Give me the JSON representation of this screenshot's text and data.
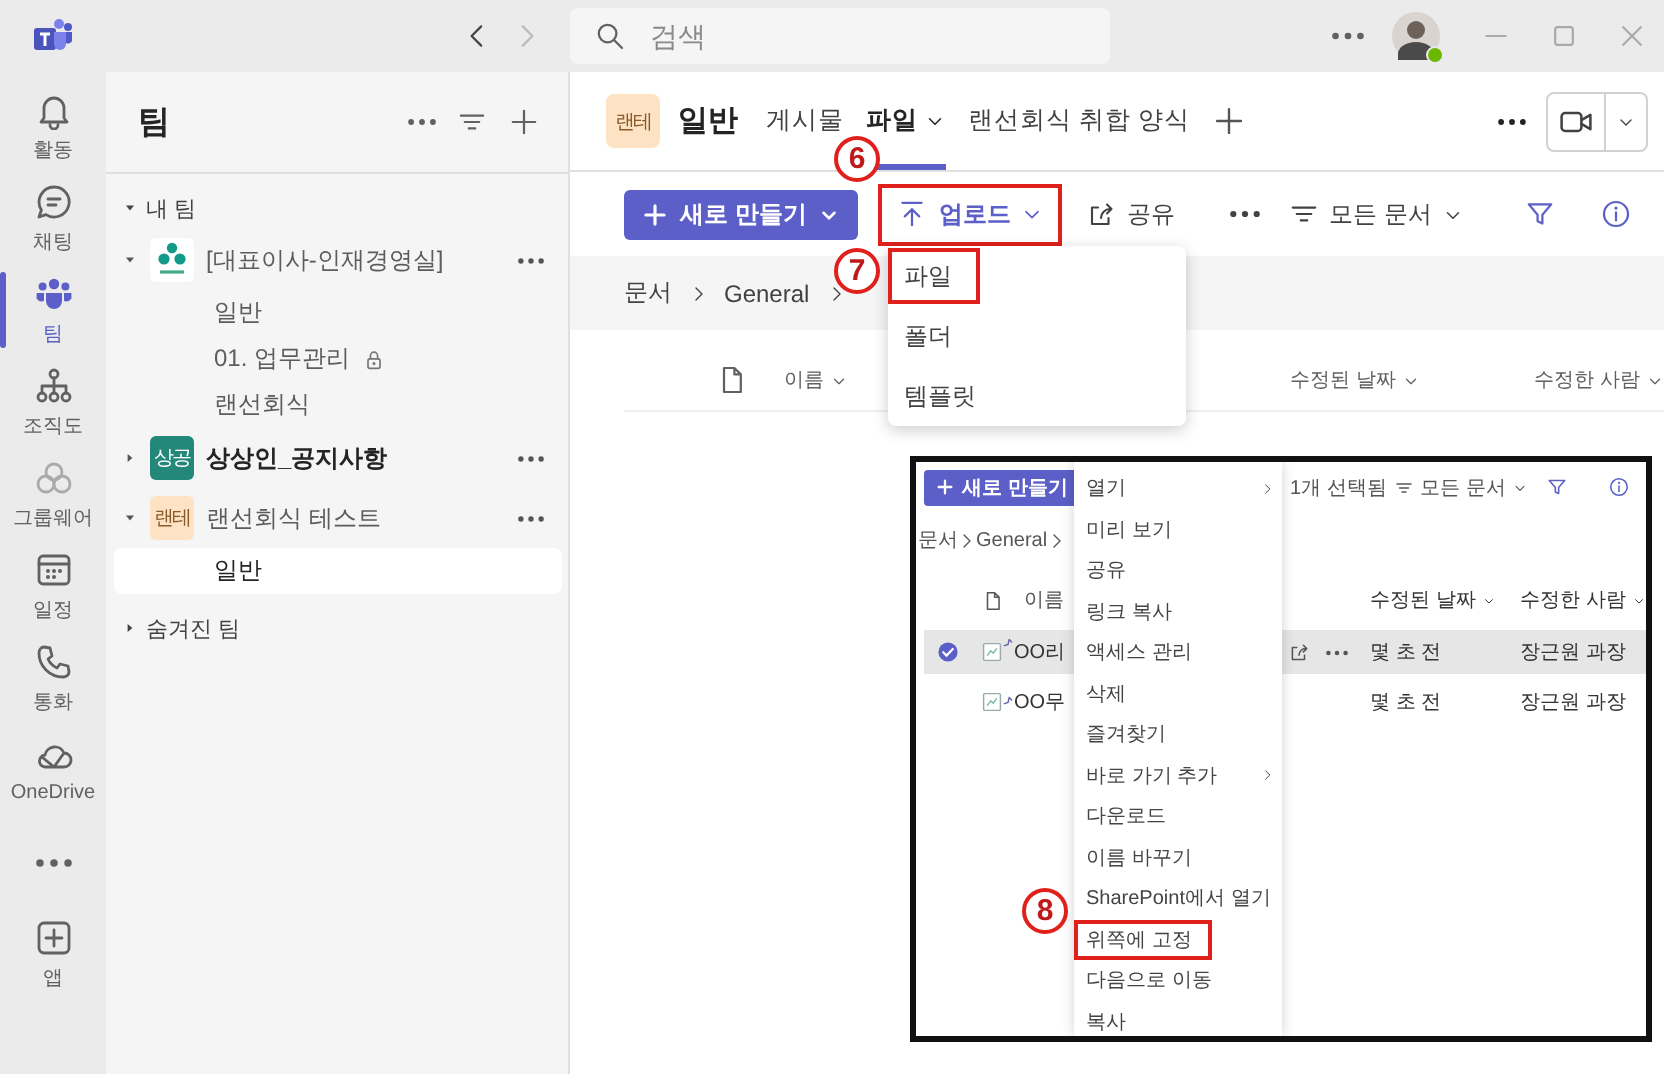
{
  "title_bar": {
    "search": {
      "placeholder": "검색"
    },
    "user": {
      "online": true
    }
  },
  "rail": [
    {
      "kind": "activity",
      "label": "활동",
      "selected": false
    },
    {
      "kind": "chat",
      "label": "채팅",
      "selected": false
    },
    {
      "kind": "teams",
      "label": "팀",
      "selected": true
    },
    {
      "kind": "org",
      "label": "조직도",
      "selected": false
    },
    {
      "kind": "groupware",
      "label": "그룹웨어",
      "selected": false
    },
    {
      "kind": "calendar",
      "label": "일정",
      "selected": false
    },
    {
      "kind": "calls",
      "label": "통화",
      "selected": false
    },
    {
      "kind": "onedrive",
      "label": "OneDrive",
      "selected": false
    },
    {
      "kind": "more",
      "selected": false
    },
    {
      "kind": "apps",
      "label": "앱",
      "selected": false
    }
  ],
  "teams_panel": {
    "title": "팀",
    "sections": [
      {
        "label": "내 팀",
        "expanded": true,
        "teams": [
          {
            "name": "[대표이사-인재경영실]",
            "avatar": {
              "kind": "logo"
            },
            "expanded": true,
            "bold": false,
            "channels": [
              {
                "label": "일반",
                "locked": false,
                "selected": false
              },
              {
                "label": "01. 업무관리",
                "locked": true,
                "selected": false
              },
              {
                "label": "랜선회식",
                "locked": false,
                "selected": false
              }
            ]
          },
          {
            "name": "상상인_공지사항",
            "avatar": {
              "kind": "initials",
              "text": "상공",
              "color": "#23877a"
            },
            "expanded": false,
            "bold": true
          },
          {
            "name": "랜선회식 테스트",
            "avatar": {
              "kind": "initials",
              "text": "랜테",
              "color": "#fde3c4"
            },
            "expanded": true,
            "bold": false,
            "channels": [
              {
                "label": "일반",
                "locked": false,
                "selected": true
              }
            ]
          }
        ]
      },
      {
        "label": "숨겨진 팀",
        "expanded": false
      }
    ]
  },
  "channel_header": {
    "team_avatar": {
      "text": "랜테",
      "color": "#fde3c4"
    },
    "title": "일반",
    "tabs": [
      {
        "label": "게시물",
        "selected": false,
        "dropdown": false
      },
      {
        "label": "파일",
        "selected": true,
        "dropdown": true
      },
      {
        "label": "랜선회식 취합 양식",
        "selected": false,
        "dropdown": false
      }
    ]
  },
  "toolbar": {
    "new_button": "새로 만들기",
    "upload_button": "업로드",
    "share_button": "공유",
    "view_menu": "모든 문서"
  },
  "breadcrumb": [
    "문서",
    "General"
  ],
  "columns": [
    "이름",
    "수정된 날짜",
    "수정한 사람"
  ],
  "upload_menu": [
    "파일",
    "폴더",
    "템플릿"
  ],
  "inset": {
    "new_button": "새로 만들기",
    "selection": "1개 선택됨",
    "view_menu": "모든 문서",
    "breadcrumb": [
      "문서",
      "General"
    ],
    "columns": [
      "이름",
      "수정된 날짜",
      "수정한 사람"
    ],
    "rows": [
      {
        "name": "OO리",
        "modified": "몇 초 전",
        "modified_by": "장근원 과장",
        "selected": true
      },
      {
        "name": "OO무",
        "modified": "몇 초 전",
        "modified_by": "장근원 과장",
        "selected": false
      }
    ],
    "context_menu": [
      {
        "label": "열기",
        "submenu": true
      },
      {
        "label": "미리 보기",
        "submenu": false
      },
      {
        "label": "공유",
        "submenu": false
      },
      {
        "label": "링크 복사",
        "submenu": false
      },
      {
        "label": "액세스 관리",
        "submenu": false
      },
      {
        "label": "삭제",
        "submenu": false
      },
      {
        "label": "즐겨찾기",
        "submenu": false
      },
      {
        "label": "바로 가기 추가",
        "submenu": true
      },
      {
        "label": "다운로드",
        "submenu": false
      },
      {
        "label": "이름 바꾸기",
        "submenu": false
      },
      {
        "label": "SharePoint에서 열기",
        "submenu": false
      },
      {
        "label": "위쪽에 고정",
        "submenu": false
      },
      {
        "label": "다음으로 이동",
        "submenu": false
      },
      {
        "label": "복사",
        "submenu": false
      }
    ]
  },
  "annotations": [
    {
      "label": "6"
    },
    {
      "label": "7"
    },
    {
      "label": "8"
    }
  ]
}
